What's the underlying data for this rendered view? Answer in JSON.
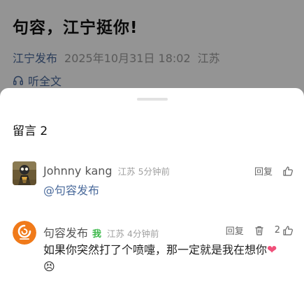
{
  "article": {
    "title": "句容，江宁挺你!",
    "source": "江宁发布",
    "time": "2025年10月31日 18:02",
    "region": "江苏",
    "listen_label": "听全文"
  },
  "comments_panel": {
    "title": "留言 2"
  },
  "comments": [
    {
      "name": "Johnny kang",
      "location": "江苏",
      "time_ago": "5分钟前",
      "text": "@句容发布",
      "reply_label": "回复"
    },
    {
      "name": "句容发布",
      "author_tag": "我",
      "location": "江苏",
      "time_ago": "4分钟前",
      "text": "如果你突然打了个喷嚏，那一定就是我在想你",
      "reply_label": "回复",
      "likes": "2",
      "emoji_heart": "❤",
      "emoji_face": "😣"
    }
  ],
  "colors": {
    "link": "#4a6a9b",
    "author_tag": "#3bb84a",
    "brand_orange": "#f07a1a"
  }
}
